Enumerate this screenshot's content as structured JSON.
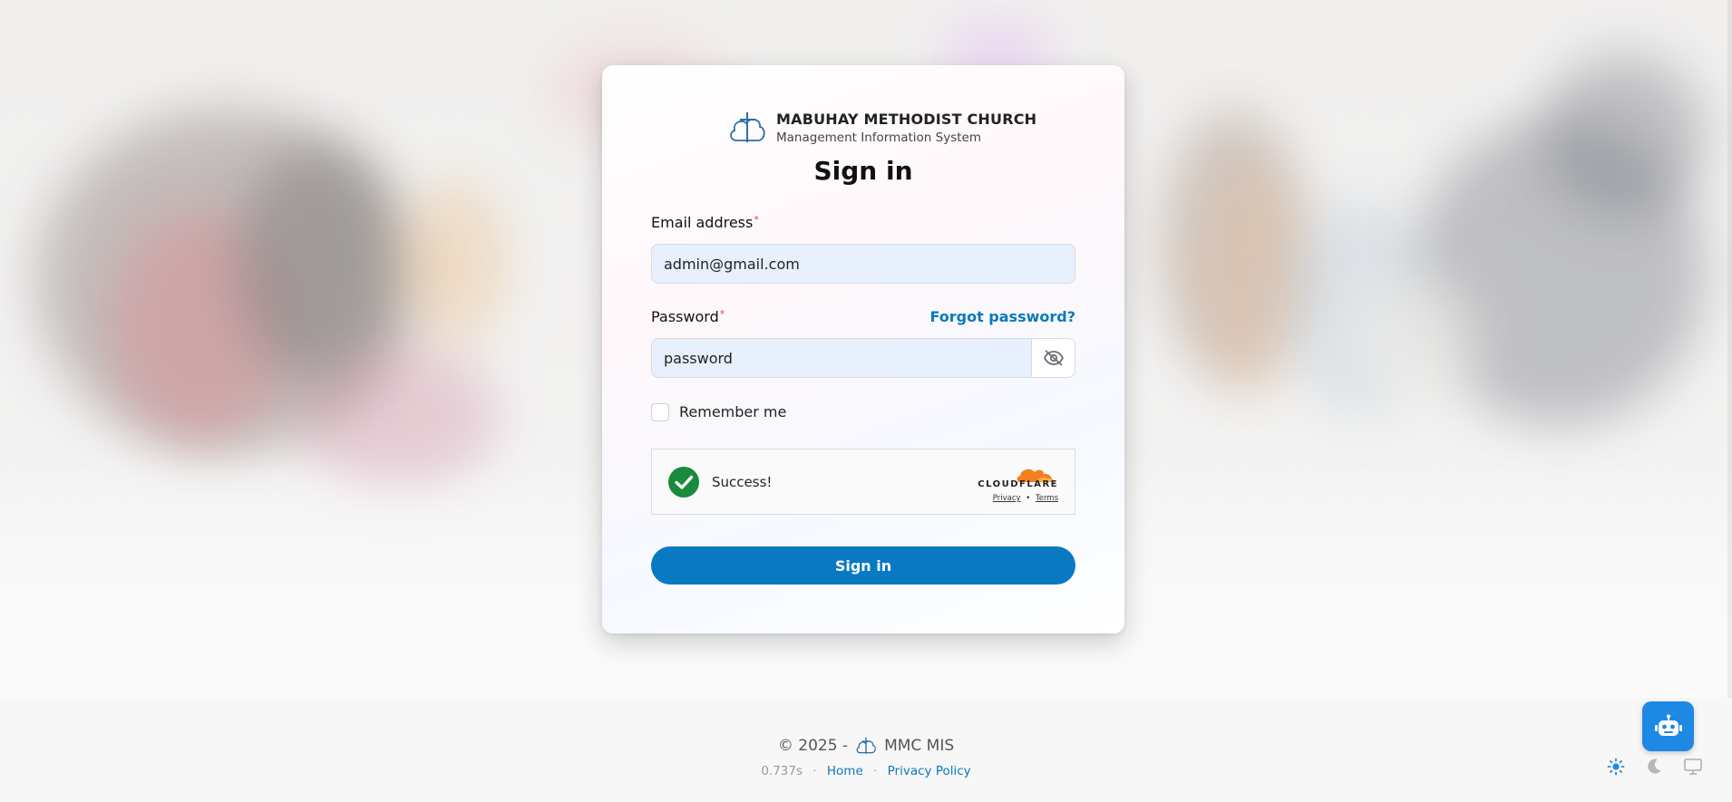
{
  "brand": {
    "name": "MABUHAY METHODIST CHURCH",
    "subtitle": "Management Information System",
    "logo_icon": "cross-cloud-icon"
  },
  "form": {
    "title": "Sign in",
    "email_label": "Email address",
    "email_value": "admin@gmail.com",
    "password_label": "Password",
    "password_value": "password",
    "forgot_label": "Forgot password?",
    "remember_label": "Remember me",
    "remember_checked": false,
    "submit_label": "Sign in",
    "required_marker": "*"
  },
  "captcha": {
    "status_text": "Success!",
    "provider": "CLOUDFLARE",
    "privacy_label": "Privacy",
    "separator": "•",
    "terms_label": "Terms"
  },
  "footer": {
    "copyright": "© 2025 -",
    "app_name": "MMC MIS",
    "load_time": "0.737s",
    "dot": "·",
    "home_label": "Home",
    "privacy_label": "Privacy Policy"
  },
  "colors": {
    "primary": "#0979c2",
    "link": "#0a7ab8",
    "success": "#1a8a3d",
    "input_bg": "#e8f0fe",
    "cloudflare_orange": "#f38020",
    "bot_button": "#1e88e5"
  }
}
